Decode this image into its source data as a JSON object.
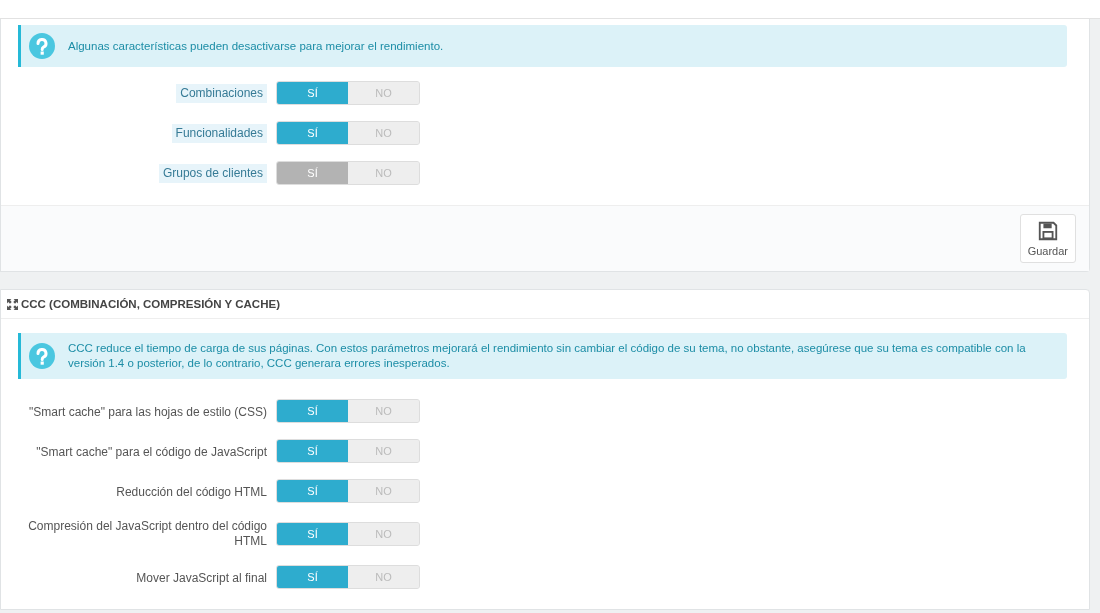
{
  "panels": [
    {
      "alert": "Algunas características pueden desactivarse para mejorar el rendimiento.",
      "fields": [
        {
          "label": "Combinaciones",
          "hint": true,
          "disabled": false,
          "options": [
            {
              "text": "SÍ",
              "selected": true
            },
            {
              "text": "NO",
              "selected": false
            }
          ]
        },
        {
          "label": "Funcionalidades",
          "hint": true,
          "disabled": false,
          "options": [
            {
              "text": "SÍ",
              "selected": true
            },
            {
              "text": "NO",
              "selected": false
            }
          ]
        },
        {
          "label": "Grupos de clientes",
          "hint": true,
          "disabled": true,
          "options": [
            {
              "text": "SÍ",
              "selected": true
            },
            {
              "text": "NO",
              "selected": false
            }
          ]
        }
      ],
      "save_button": "Guardar"
    },
    {
      "title": "CCC (COMBINACIÓN, COMPRESIÓN Y CACHE)",
      "alert": "CCC reduce el tiempo de carga de sus páginas. Con estos parámetros mejorará el rendimiento sin cambiar el código de su tema, no obstante, asegúrese que su tema es compatible con la versión 1.4 o posterior, de lo contrario, CCC generara errores inesperados.",
      "fields": [
        {
          "label": "\"Smart cache\" para las hojas de estilo (CSS)",
          "hint": false,
          "disabled": false,
          "options": [
            {
              "text": "SÍ",
              "selected": true
            },
            {
              "text": "NO",
              "selected": false
            }
          ]
        },
        {
          "label": "\"Smart cache\" para el código de JavaScript",
          "hint": false,
          "disabled": false,
          "options": [
            {
              "text": "SÍ",
              "selected": true
            },
            {
              "text": "NO",
              "selected": false
            }
          ]
        },
        {
          "label": "Reducción del código HTML",
          "hint": false,
          "disabled": false,
          "options": [
            {
              "text": "SÍ",
              "selected": true
            },
            {
              "text": "NO",
              "selected": false
            }
          ]
        },
        {
          "label": "Compresión del JavaScript dentro del código HTML",
          "hint": false,
          "disabled": false,
          "options": [
            {
              "text": "SÍ",
              "selected": true
            },
            {
              "text": "NO",
              "selected": false
            }
          ]
        },
        {
          "label": "Mover JavaScript al final",
          "hint": false,
          "disabled": false,
          "options": [
            {
              "text": "SÍ",
              "selected": true
            },
            {
              "text": "NO",
              "selected": false
            }
          ]
        }
      ]
    }
  ]
}
